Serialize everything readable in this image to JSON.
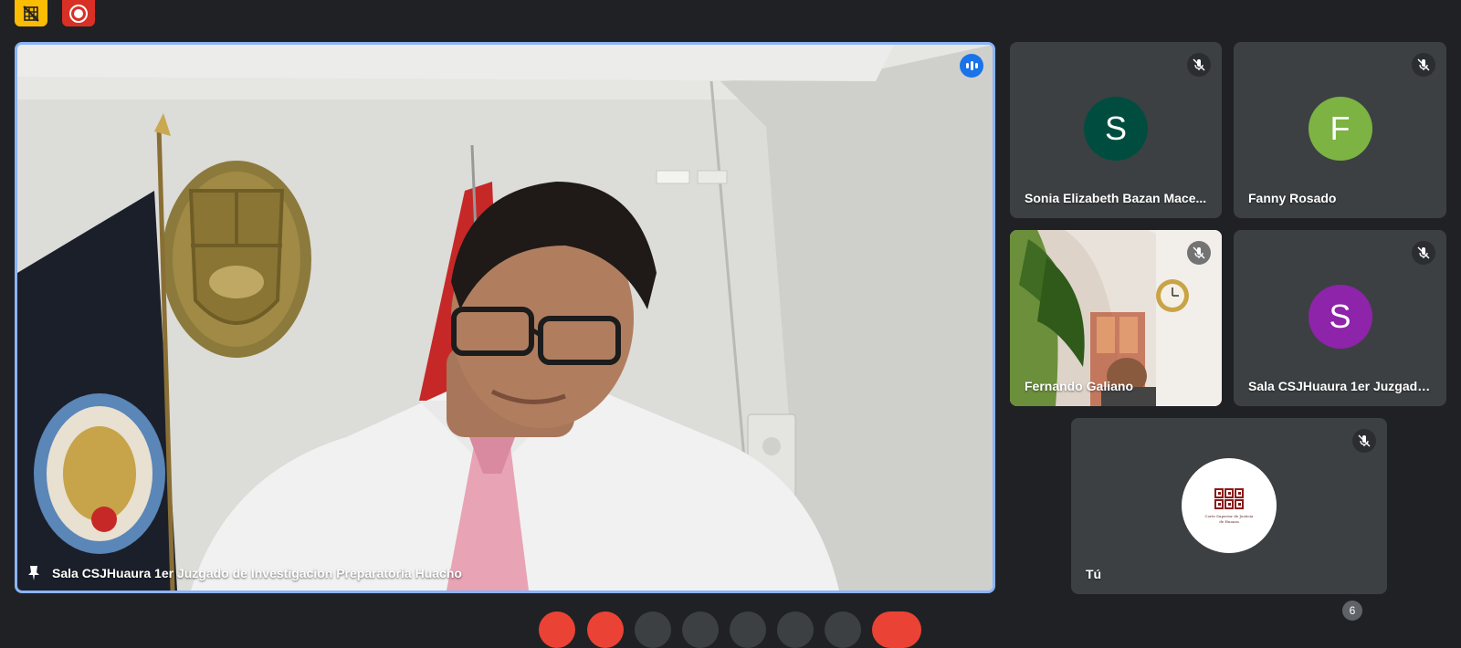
{
  "top_bar": {
    "icons": [
      "grid-off-icon",
      "record-icon"
    ],
    "colors": {
      "grid_off_bg": "#fbbc04",
      "record_bg": "#d93025"
    }
  },
  "main_speaker": {
    "name": "Sala CSJHuaura 1er Juzgado de Investigacion Preparatoria Huacho",
    "pinned_icon": "pin-icon",
    "speaking_icon": "speaking-indicator-icon",
    "highlight_color": "#8ab4f8"
  },
  "participants": [
    {
      "name": "Sonia Elizabeth Bazan Mace...",
      "initial": "S",
      "avatar_color": "#004d40",
      "muted": true
    },
    {
      "name": "Fanny Rosado",
      "initial": "F",
      "avatar_color": "#7cb342",
      "muted": true
    },
    {
      "name": "Fernando Galiano",
      "initial": "",
      "avatar_color": "",
      "muted": true,
      "has_video": true
    },
    {
      "name": "Sala CSJHuaura 1er Juzgado...",
      "initial": "S",
      "avatar_color": "#8e24aa",
      "muted": true
    }
  ],
  "self": {
    "name": "Tú",
    "logo_text_line1": "Corte Superior de Justicia",
    "logo_text_line2": "de Huaura",
    "muted": true
  },
  "controls": {
    "participant_count": "6"
  }
}
